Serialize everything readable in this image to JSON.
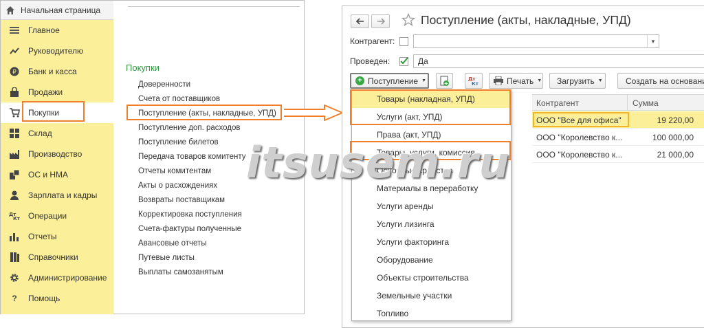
{
  "home_tab": {
    "label": "Начальная страница"
  },
  "sections": [
    {
      "label": "Главное",
      "icon": "menu-lines-icon"
    },
    {
      "label": "Руководителю",
      "icon": "trend-chart-icon"
    },
    {
      "label": "Банк и касса",
      "icon": "ruble-coin-icon"
    },
    {
      "label": "Продажи",
      "icon": "shopping-bag-icon"
    },
    {
      "label": "Покупки",
      "icon": "shopping-cart-icon"
    },
    {
      "label": "Склад",
      "icon": "warehouse-icon"
    },
    {
      "label": "Производство",
      "icon": "factory-icon"
    },
    {
      "label": "ОС и НМА",
      "icon": "assets-icon"
    },
    {
      "label": "Зарплата и кадры",
      "icon": "person-icon"
    },
    {
      "label": "Операции",
      "icon": "dt-kt-icon"
    },
    {
      "label": "Отчеты",
      "icon": "bar-chart-icon"
    },
    {
      "label": "Справочники",
      "icon": "books-icon"
    },
    {
      "label": "Администрирование",
      "icon": "gear-icon"
    },
    {
      "label": "Помощь",
      "icon": "question-icon"
    }
  ],
  "active_section": "Покупки",
  "submenu": {
    "title": "Покупки",
    "items": [
      "Доверенности",
      "Счета от поставщиков",
      "Поступление (акты, накладные, УПД)",
      "Поступление доп. расходов",
      "Поступление билетов",
      "Передача товаров комитенту",
      "Отчеты комитентам",
      "Акты о расхождениях",
      "Возвраты поставщикам",
      "Корректировка поступления",
      "Счета-фактуры полученные",
      "Авансовые отчеты",
      "Путевые листы",
      "Выплаты самозанятым"
    ]
  },
  "window": {
    "title": "Поступление (акты, накладные, УПД)",
    "kontragent_label": "Контрагент:",
    "kontragent_value": "",
    "proveden_label": "Проведен:",
    "proveden_checked": true,
    "proveden_value": "Да",
    "toolbar": {
      "post_button": "Поступление",
      "print_button": "Печать",
      "load_button": "Загрузить",
      "create_button": "Создать на основани"
    },
    "table": {
      "headers": [
        "Контрагент",
        "Сумма"
      ],
      "rows": [
        {
          "kontragent": "ООО \"Все для офиса\"",
          "summa": "19 220,00"
        },
        {
          "kontragent": "ООО \"Королевство к...",
          "summa": "100 000,00"
        },
        {
          "kontragent": "ООО \"Королевство к...",
          "summa": "21 000,00"
        }
      ]
    },
    "dropdown_items": [
      "Товары (накладная, УПД)",
      "Услуги (акт, УПД)",
      "Права (акт, УПД)",
      "Товары, услуги, комиссия",
      "Основные средства",
      "Материалы в переработку",
      "Услуги аренды",
      "Услуги лизинга",
      "Услуги факторинга",
      "Оборудование",
      "Объекты строительства",
      "Земельные участки",
      "Топливо"
    ]
  },
  "watermark": "itsusem.ru",
  "colors": {
    "section_bg": "#fbef9a",
    "highlight_orange": "#f07f2a",
    "submenu_title_green": "#2d9a3c",
    "selection_yellow": "#fbef9a"
  }
}
